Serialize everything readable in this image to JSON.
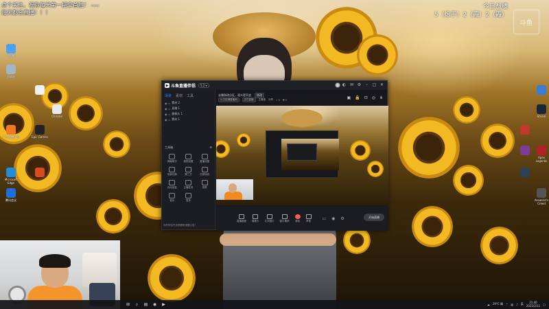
{
  "overlay": {
    "line1": "点个关注，祝你每天第一把拿首胜！",
    "line1_tag": "••••",
    "line2": "每天都会直播！！！"
  },
  "stats": {
    "title": "今日战绩",
    "record": "5（炮手）2（霞）2（霞）"
  },
  "desktop_left_icons": [
    {
      "label": "此电脑",
      "icon": "computer-icon",
      "color": "#4aa3f0"
    },
    {
      "label": "回收站",
      "icon": "recycle-bin-icon",
      "color": "#9fb7c9"
    },
    {
      "label": "",
      "icon": "file-icon",
      "color": "#f0f0f0"
    },
    {
      "label": "Chrome",
      "icon": "chrome-icon",
      "color": "#e9e9e9"
    },
    {
      "label": "Epic Games",
      "icon": "epic-icon",
      "color": "#222222"
    },
    {
      "label": "斗鱼直播伴侣",
      "icon": "app-icon",
      "color": "#f07a22"
    },
    {
      "label": "Microsoft Edge",
      "icon": "edge-icon",
      "color": "#1e8fd6"
    },
    {
      "label": "",
      "icon": "app-icon",
      "color": "#d94a1e"
    },
    {
      "label": "腾讯会议",
      "icon": "meeting-icon",
      "color": "#1e6fd9"
    }
  ],
  "desktop_right_icons": [
    {
      "label": "",
      "icon": "app-icon",
      "color": "#3a7bd5"
    },
    {
      "label": "Steam",
      "icon": "steam-icon",
      "color": "#1b2838"
    },
    {
      "label": "",
      "icon": "game-icon",
      "color": "#c0392b"
    },
    {
      "label": "",
      "icon": "game-icon",
      "color": "#7d3c98"
    },
    {
      "label": "Apex Legends",
      "icon": "apex-icon",
      "color": "#b22222"
    },
    {
      "label": "",
      "icon": "game-icon",
      "color": "#2e4053"
    },
    {
      "label": "Assassin's Creed",
      "icon": "game-icon",
      "color": "#555555"
    }
  ],
  "app": {
    "title": "斗鱼直播伴侣",
    "version": "5.2 ▾",
    "tabs": [
      "场景",
      "素材",
      "工具"
    ],
    "scenes": [
      "素材 2",
      "直播 1",
      "摄像头 1",
      "素材 1"
    ],
    "room_info": "去播和改分区，观众更开放",
    "room_tag": "修改",
    "info_line2": [
      "火力拉满直播间",
      "正在直播",
      "主播端",
      "分享",
      "⚡ 0",
      "❤ 0"
    ],
    "tools_title": "工具箱",
    "tools": [
      "弹幕助手",
      "美颜设置",
      "直播设置",
      "场景切换",
      "第三方",
      "礼物特效",
      "自动回复",
      "主播任务",
      "录屏",
      "音乐",
      "更多"
    ],
    "footer_tip": "你的伴侣不定期更新重要公告！",
    "toolbar": [
      "直播画面",
      "摄像头",
      "文字图片",
      "窗口捕获",
      "录制",
      "声音"
    ],
    "start_label": "开始直播"
  },
  "taskbar": {
    "tray_text": "29°C 晴",
    "lang": "英",
    "time": "21:40",
    "date": "2022/2/11"
  },
  "watermark": "斗鱼"
}
